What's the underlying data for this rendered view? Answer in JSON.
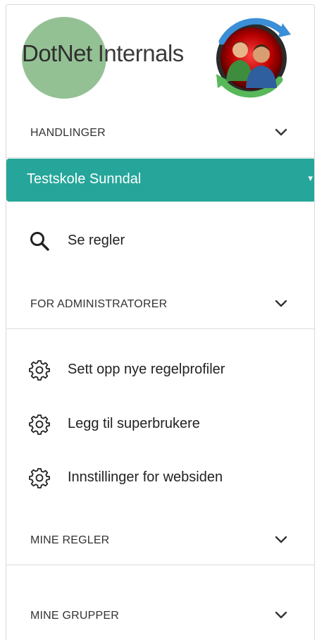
{
  "logo": {
    "text_part1": "DotNet",
    "text_part2": "Internals",
    "image_icon": "users-logo-icon"
  },
  "sections": {
    "handlinger": "HANDLINGER",
    "admin": "FOR ADMINISTRATORER",
    "mine_regler": "MINE REGLER",
    "mine_grupper": "MINE GRUPPER"
  },
  "school": {
    "label": "Testskole Sunndal",
    "caret": "▾"
  },
  "actions": [
    {
      "label": "Se regler",
      "icon": "search-icon"
    }
  ],
  "admin_items": [
    {
      "label": "Sett opp nye regelprofiler",
      "icon": "gear-icon"
    },
    {
      "label": "Legg til superbrukere",
      "icon": "gear-icon"
    },
    {
      "label": "Innstillinger for websiden",
      "icon": "gear-icon"
    }
  ],
  "colors": {
    "accent": "#26a69a",
    "logo_circle": "#94c194"
  }
}
